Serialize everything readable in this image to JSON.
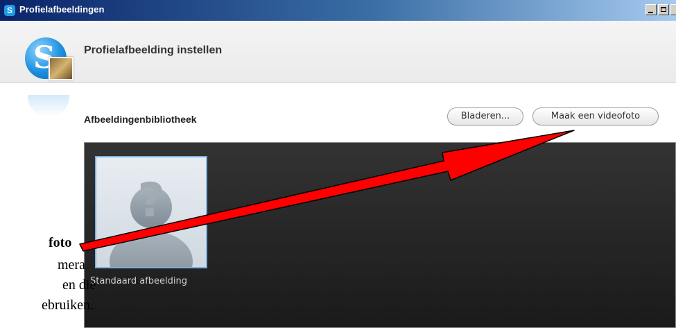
{
  "window": {
    "title": "Profielafbeeldingen"
  },
  "header": {
    "title": "Profielafbeelding instellen"
  },
  "library": {
    "heading": "Afbeeldingenbibliotheek",
    "browse_label": "Bladeren...",
    "video_label": "Maak een videofoto",
    "tile_caption": "Standaard afbeelding",
    "placeholder_glyph": "?"
  },
  "annotation": {
    "bold_line": "foto",
    "line1": "mera",
    "line2": "en die",
    "line3": "ebruiken."
  },
  "colors": {
    "arrow": "#ff0000",
    "accent": "#1b8fe0"
  }
}
